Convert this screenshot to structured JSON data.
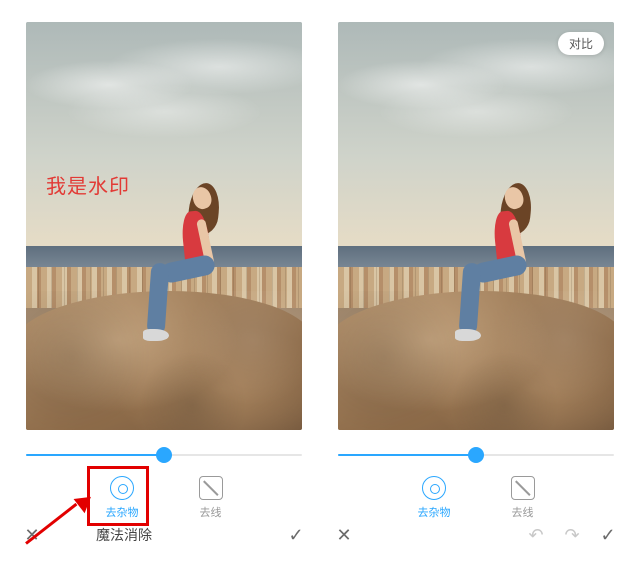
{
  "panels": {
    "left": {
      "watermark_text": "我是水印",
      "slider": {
        "value": 50,
        "fill_percent": 50
      },
      "tools": [
        {
          "key": "remove-object",
          "label": "去杂物",
          "active": true
        },
        {
          "key": "remove-line",
          "label": "去线",
          "active": false
        }
      ],
      "bottom": {
        "title": "魔法消除"
      },
      "highlight_tool_index": 0
    },
    "right": {
      "compare_label": "对比",
      "slider": {
        "value": 50,
        "fill_percent": 50
      },
      "tools": [
        {
          "key": "remove-object",
          "label": "去杂物",
          "active": true
        },
        {
          "key": "remove-line",
          "label": "去线",
          "active": false
        }
      ],
      "bottom": {
        "title": ""
      }
    }
  },
  "colors": {
    "accent": "#2aa7ff",
    "annotation": "#e20000",
    "watermark": "#e23a35"
  }
}
